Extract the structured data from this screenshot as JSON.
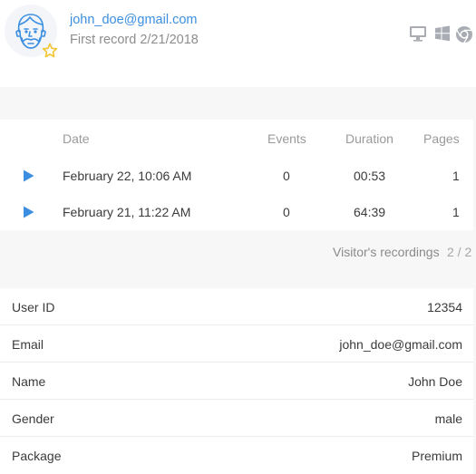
{
  "header": {
    "email": "john_doe@gmail.com",
    "first_record": "First record 2/21/2018",
    "platform_icons": [
      "monitor-icon",
      "windows-icon",
      "chrome-icon"
    ]
  },
  "recordings": {
    "columns": {
      "date": "Date",
      "events": "Events",
      "duration": "Duration",
      "pages": "Pages"
    },
    "rows": [
      {
        "date": "February 22, 10:06 AM",
        "events": "0",
        "duration": "00:53",
        "pages": "1"
      },
      {
        "date": "February 21, 11:22 AM",
        "events": "0",
        "duration": "64:39",
        "pages": "1"
      }
    ],
    "pager_label": "Visitor's recordings",
    "pager_count": "2 / 2"
  },
  "properties": [
    {
      "key": "User ID",
      "value": "12354"
    },
    {
      "key": "Email",
      "value": "john_doe@gmail.com"
    },
    {
      "key": "Name",
      "value": "John Doe"
    },
    {
      "key": "Gender",
      "value": "male"
    },
    {
      "key": "Package",
      "value": "Premium"
    }
  ],
  "colors": {
    "accent": "#3c8fe0",
    "star": "#f2c531",
    "muted_text": "#8d8d8d",
    "page_bg": "#f7f7f7"
  }
}
